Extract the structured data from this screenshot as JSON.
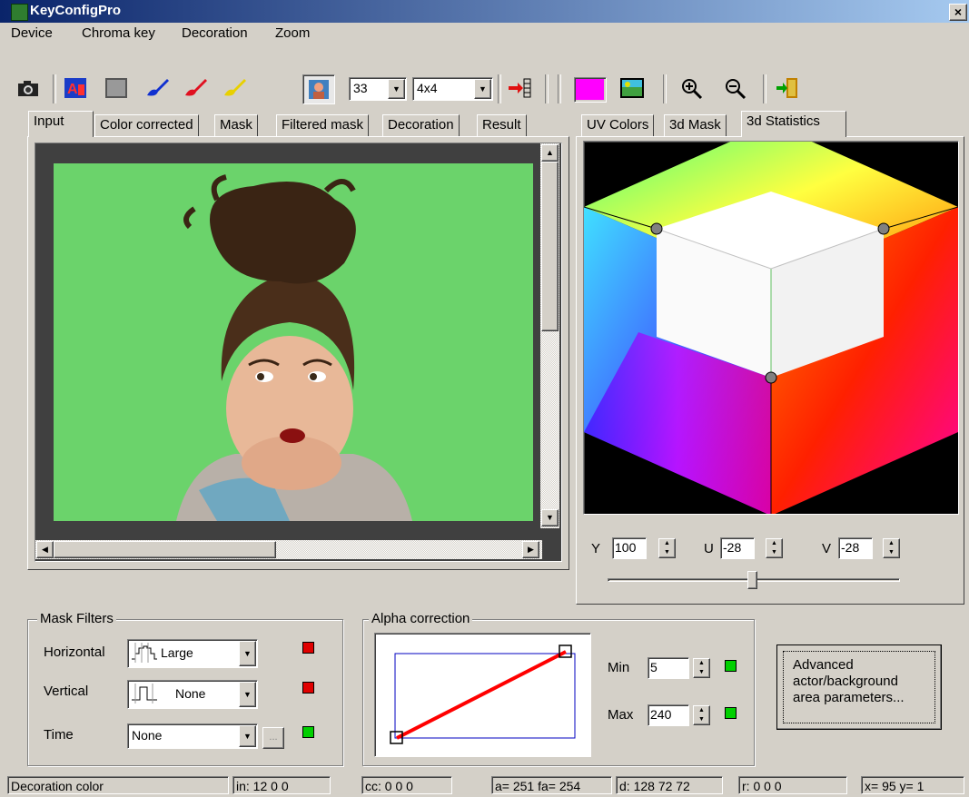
{
  "app": {
    "title": "KeyConfigPro",
    "close_glyph": "×"
  },
  "menu": [
    "Device",
    "Chroma key",
    "Decoration",
    "Zoom"
  ],
  "toolbar": {
    "buttons": [
      "camera-icon",
      "actor-background-icon",
      "mask-pattern-icon",
      "brush-blue-icon",
      "brush-red-icon",
      "brush-yellow-icon",
      "portrait-icon",
      "insert-arrow-icon",
      "magenta-color-icon",
      "landscape-icon",
      "zoom-in-icon",
      "zoom-out-icon",
      "exit-icon"
    ],
    "number_combo": "33",
    "grid_combo": "4x4",
    "colors": {
      "magenta": "#ff00ff",
      "active_bg": "#e8e8e8"
    }
  },
  "left_tabs": [
    "Input",
    "Color corrected",
    "Mask",
    "Filtered mask",
    "Decoration",
    "Result"
  ],
  "left_active_tab": "Input",
  "right_tabs": [
    "UV Colors",
    "3d Mask",
    "3d Statistics"
  ],
  "right_active_tab": "3d Statistics",
  "image": {
    "background_color": "#6bd36b"
  },
  "yuv": {
    "y_label": "Y",
    "y": "100",
    "u_label": "U",
    "u": "-28",
    "v_label": "V",
    "v": "-28"
  },
  "mask_filters": {
    "title": "Mask Filters",
    "horizontal_label": "Horizontal",
    "horizontal_value": "Large",
    "vertical_label": "Vertical",
    "vertical_value": "None",
    "time_label": "Time",
    "time_value": "None",
    "ellipsis": "..."
  },
  "alpha": {
    "title": "Alpha correction",
    "min_label": "Min",
    "min": "5",
    "max_label": "Max",
    "max": "240"
  },
  "advanced_button": "Advanced\nactor/background\narea parameters...",
  "status": [
    "Decoration color",
    "in: 12  0  0",
    "cc:  0  0  0",
    "a= 251 fa= 254",
    "d: 128  72  72",
    "r:  0  0  0",
    "x= 95 y=  1"
  ],
  "colors": {
    "red_led": "#e00000",
    "green_led": "#00d000",
    "curve": "#ff0000",
    "box": "#0000c0"
  }
}
